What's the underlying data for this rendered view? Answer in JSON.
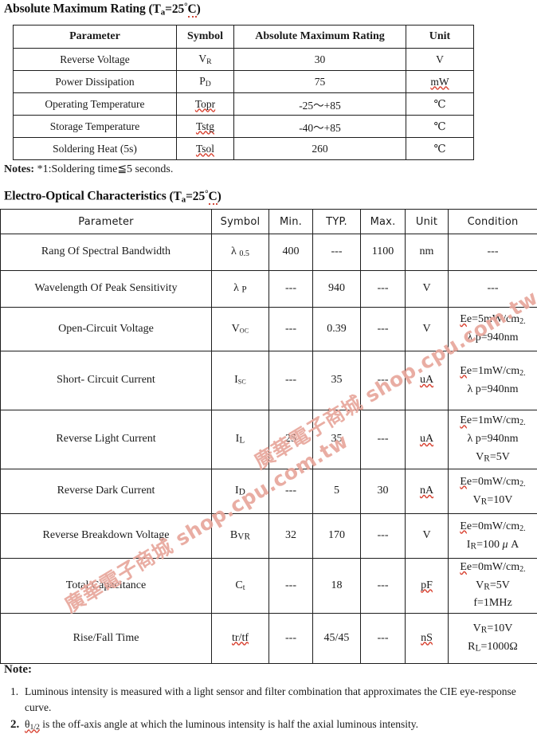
{
  "document": {
    "absolute_maximum_rating": {
      "title_main": "Absolute Maximum Rating",
      "title_cond_prefix": "(T",
      "title_cond_sub": "a",
      "title_cond_value": "=25",
      "title_cond_unit": "C",
      "title_cond_suffix": ")",
      "headers": [
        "Parameter",
        "Symbol",
        "Absolute Maximum Rating",
        "Unit"
      ],
      "rows": [
        {
          "parameter": "Reverse Voltage",
          "symbol_base": "V",
          "symbol_sub": "R",
          "rating": "30",
          "unit": "V",
          "unit_spell": false,
          "symbol_spell": false
        },
        {
          "parameter": "Power Dissipation",
          "symbol_base": "P",
          "symbol_sub": "D",
          "rating": "75",
          "unit": "mW",
          "unit_spell": true,
          "symbol_spell": false
        },
        {
          "parameter": "Operating Temperature",
          "symbol_base": "Topr",
          "symbol_sub": "",
          "rating": "-25〜+85",
          "unit": "℃",
          "unit_spell": false,
          "symbol_spell": true
        },
        {
          "parameter": "Storage Temperature",
          "symbol_base": "Tstg",
          "symbol_sub": "",
          "rating": "-40〜+85",
          "unit": "℃",
          "unit_spell": false,
          "symbol_spell": true
        },
        {
          "parameter": "Soldering Heat (5s)",
          "symbol_base": "Tsol",
          "symbol_sub": "",
          "rating": "260",
          "unit": "℃",
          "unit_spell": false,
          "symbol_spell": true
        }
      ]
    },
    "notes_line": {
      "label": "Notes:",
      "text": " *1:Soldering time≦5 seconds."
    },
    "electro_optical": {
      "title_main": "Electro-Optical Characteristics",
      "title_cond_prefix": "(T",
      "title_cond_sub": "a",
      "title_cond_value": "=25",
      "title_cond_unit": "C",
      "title_cond_suffix": ")",
      "headers": [
        "Parameter",
        "Symbol",
        "Min.",
        "TYP.",
        "Max.",
        "Unit",
        "Condition"
      ],
      "rows": [
        {
          "parameter": "Rang Of Spectral Bandwidth",
          "symbol": "λ 0.5",
          "min": "400",
          "typ": "---",
          "max": "1100",
          "unit": "nm",
          "unit_spell": false,
          "conditions": [
            "---"
          ]
        },
        {
          "parameter": "Wavelength Of Peak Sensitivity",
          "symbol": "λ P",
          "min": "---",
          "typ": "940",
          "max": "---",
          "unit": "V",
          "unit_spell": false,
          "conditions": [
            "---"
          ]
        },
        {
          "parameter": "Open-Circuit Voltage",
          "symbol": "Voc",
          "min": "---",
          "typ": "0.39",
          "max": "---",
          "unit": "V",
          "unit_spell": false,
          "conditions": [
            "Ee=5mW/cm2.",
            "λ p=940nm"
          ]
        },
        {
          "parameter": "Short- Circuit Current",
          "symbol": "Isc",
          "min": "---",
          "typ": "35",
          "max": "---",
          "unit": "uA",
          "unit_spell": true,
          "conditions": [
            "Ee=1mW/cm2.",
            "λ p=940nm"
          ]
        },
        {
          "parameter": "Reverse Light Current",
          "symbol": "IL",
          "min": "25",
          "typ": "35",
          "max": "---",
          "unit": "uA",
          "unit_spell": true,
          "conditions": [
            "Ee=1mW/cm2.",
            "λ p=940nm",
            "VR=5V"
          ]
        },
        {
          "parameter": "Reverse Dark Current",
          "symbol": "ID",
          "min": "---",
          "typ": "5",
          "max": "30",
          "unit": "nA",
          "unit_spell": true,
          "conditions": [
            "Ee=0mW/cm2.",
            "VR=10V"
          ]
        },
        {
          "parameter": "Reverse Breakdown Voltage",
          "symbol": "BVR",
          "min": "32",
          "typ": "170",
          "max": "---",
          "unit": "V",
          "unit_spell": false,
          "conditions": [
            "Ee=0mW/cm2.",
            "IR=100 μ A"
          ]
        },
        {
          "parameter": "Total Capacitance",
          "symbol": "Ct",
          "min": "---",
          "typ": "18",
          "max": "---",
          "unit": "pF",
          "unit_spell": true,
          "conditions": [
            "Ee=0mW/cm2.",
            "VR=5V",
            "f=1MHz"
          ]
        },
        {
          "parameter": "Rise/Fall Time",
          "symbol": "tr/tf",
          "min": "---",
          "typ": "45/45",
          "max": "---",
          "unit": "nS",
          "unit_spell": true,
          "conditions": [
            "VR=10V",
            "RL=1000Ω"
          ]
        }
      ]
    },
    "bottom_note": {
      "heading": "Note:",
      "items": [
        {
          "number": "1.",
          "bold_number": false,
          "text": "Luminous intensity is measured with a light sensor and filter combination that approximates the CIE eye-response curve."
        },
        {
          "number": "2.",
          "bold_number": true,
          "text": "θ1/2 is the off-axis angle at which the luminous intensity is half the axial luminous intensity."
        }
      ]
    },
    "watermark": {
      "line1": "廣華電子商城 shop.cpu.com.tw",
      "line2": "廣華電子商城 shop.cpu.com.tw",
      "color": "#e8a79c"
    }
  }
}
